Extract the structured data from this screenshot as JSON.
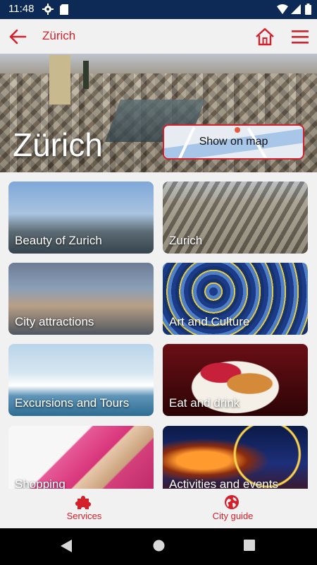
{
  "status_bar": {
    "time": "11:48"
  },
  "app_bar": {
    "title": "Zürich"
  },
  "hero": {
    "city_name": "Zürich",
    "map_button_label": "Show on map"
  },
  "categories": [
    {
      "label": "Beauty of Zurich"
    },
    {
      "label": "Zurich"
    },
    {
      "label": "City attractions"
    },
    {
      "label": "Art and Culture"
    },
    {
      "label": "Excursions and Tours"
    },
    {
      "label": "Eat and drink"
    },
    {
      "label": "Shopping"
    },
    {
      "label": "Activities and events"
    }
  ],
  "bottom_nav": {
    "items": [
      {
        "label": "Services",
        "icon": "puzzle-icon"
      },
      {
        "label": "City guide",
        "icon": "globe-icon"
      }
    ]
  },
  "colors": {
    "accent": "#d3202a",
    "status_bar": "#0d2a57",
    "background": "#f1f1f1"
  }
}
